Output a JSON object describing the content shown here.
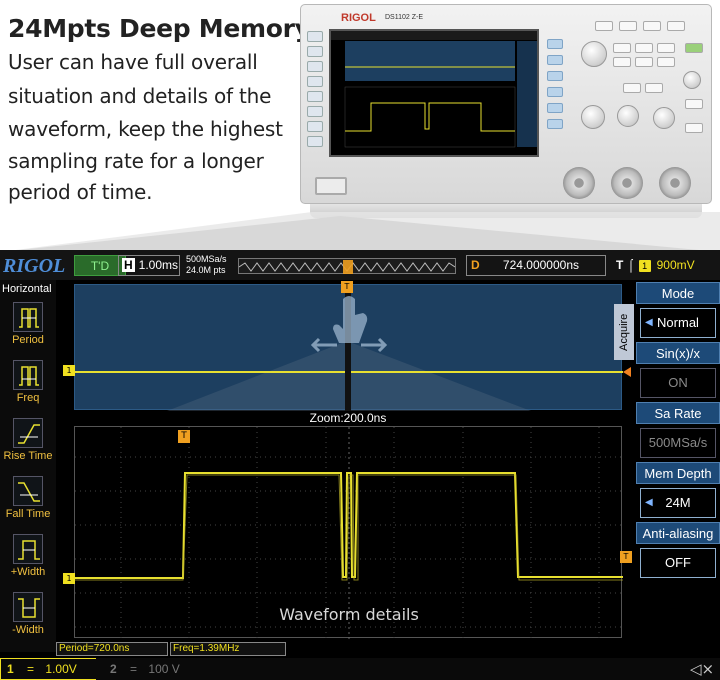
{
  "promo": {
    "title": "24Mpts  Deep Memory",
    "lines": [
      "User can have full overall",
      "situation and details of the",
      "waveform, keep the highest",
      "sampling rate for a longer",
      "period of time."
    ]
  },
  "device": {
    "brand": "RIGOL",
    "model": "DS1102 Z-E"
  },
  "scope": {
    "logo": "RIGOL",
    "trigger_status": "T'D",
    "timebase": {
      "letter": "H",
      "value": "1.00ms"
    },
    "sample_rate": "500MSa/s",
    "memory_points": "24.0M pts",
    "delay": {
      "letter": "D",
      "value": "724.000000ns"
    },
    "trigger": {
      "letter": "T",
      "edge": "f",
      "channel": "1",
      "level": "900mV"
    },
    "left_menu": {
      "title": "Horizontal",
      "items": [
        {
          "label": "Period"
        },
        {
          "label": "Freq"
        },
        {
          "label": "Rise Time"
        },
        {
          "label": "Fall Time"
        },
        {
          "label": "+Width"
        },
        {
          "label": "-Width"
        }
      ]
    },
    "right_menu": {
      "tab": "Acquire",
      "items": [
        {
          "title": "Mode",
          "value": "Normal"
        },
        {
          "title": "Sin(x)/x",
          "value": "ON"
        },
        {
          "title": "Sa Rate",
          "value": "500MSa/s"
        },
        {
          "title": "Mem Depth",
          "value": "24M"
        },
        {
          "title": "Anti-aliasing",
          "value": "OFF"
        }
      ]
    },
    "zoom_label": "Zoom:200.0ns",
    "detail_label": "Waveform details",
    "channel_marker": "1",
    "trigger_marker": "T",
    "measurements": {
      "period": "Period=720.0ns",
      "freq": "Freq=1.39MHz"
    },
    "channels": [
      {
        "num": "1",
        "coupling": "=",
        "scale": "1.00V"
      },
      {
        "num": "2",
        "coupling": "=",
        "scale": "100 V"
      }
    ]
  },
  "colors": {
    "ch1": "#f0e020",
    "trigger_marker": "#f0a020",
    "overview_bg": "#1d3f60",
    "menu_title_bg": "#1d4a78"
  }
}
